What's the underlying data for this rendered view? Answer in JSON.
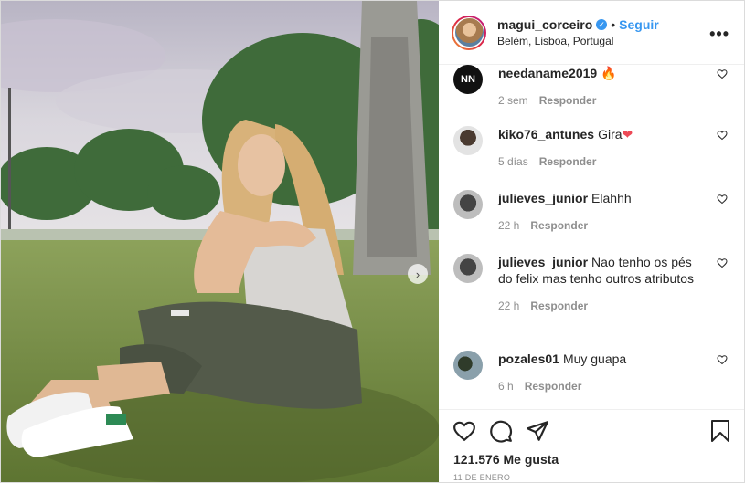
{
  "post": {
    "username": "magui_corceiro",
    "verified_icon": "verified-badge-icon",
    "separator": "•",
    "follow_label": "Seguir",
    "location": "Belém, Lisboa, Portugal",
    "more_icon": "more-options-icon",
    "more_glyph": "•••"
  },
  "comments": [
    {
      "user": "needaname2019",
      "text": "",
      "emoji": "🔥",
      "time": "2 sem",
      "reply": "Responder",
      "avatar_color": "#111111"
    },
    {
      "user": "kiko76_antunes",
      "text": "Gira",
      "emoji": "❤",
      "time": "5 días",
      "reply": "Responder",
      "avatar_color": "#7a6b62"
    },
    {
      "user": "julieves_junior",
      "text": "Elahhh",
      "emoji": "",
      "time": "22 h",
      "reply": "Responder",
      "avatar_color": "#6f6f6f"
    },
    {
      "user": "julieves_junior",
      "text": "Nao tenho os pés do felix mas tenho outros atributos",
      "emoji": "",
      "time": "22 h",
      "reply": "Responder",
      "avatar_color": "#6f6f6f"
    },
    {
      "user": "pozales01",
      "text": "Muy guapa",
      "emoji": "",
      "time": "6 h",
      "reply": "Responder",
      "avatar_color": "#4d6b7a"
    }
  ],
  "actions": {
    "like_icon": "heart-icon",
    "comment_icon": "comment-icon",
    "share_icon": "share-icon",
    "save_icon": "bookmark-icon"
  },
  "likes_text": "121.576 Me gusta",
  "date_text": "11 DE ENERO",
  "carousel_next_glyph": "›",
  "colors": {
    "accent": "#3897f0",
    "text": "#262626",
    "muted": "#8e8e8e",
    "like_red": "#ed4956"
  }
}
